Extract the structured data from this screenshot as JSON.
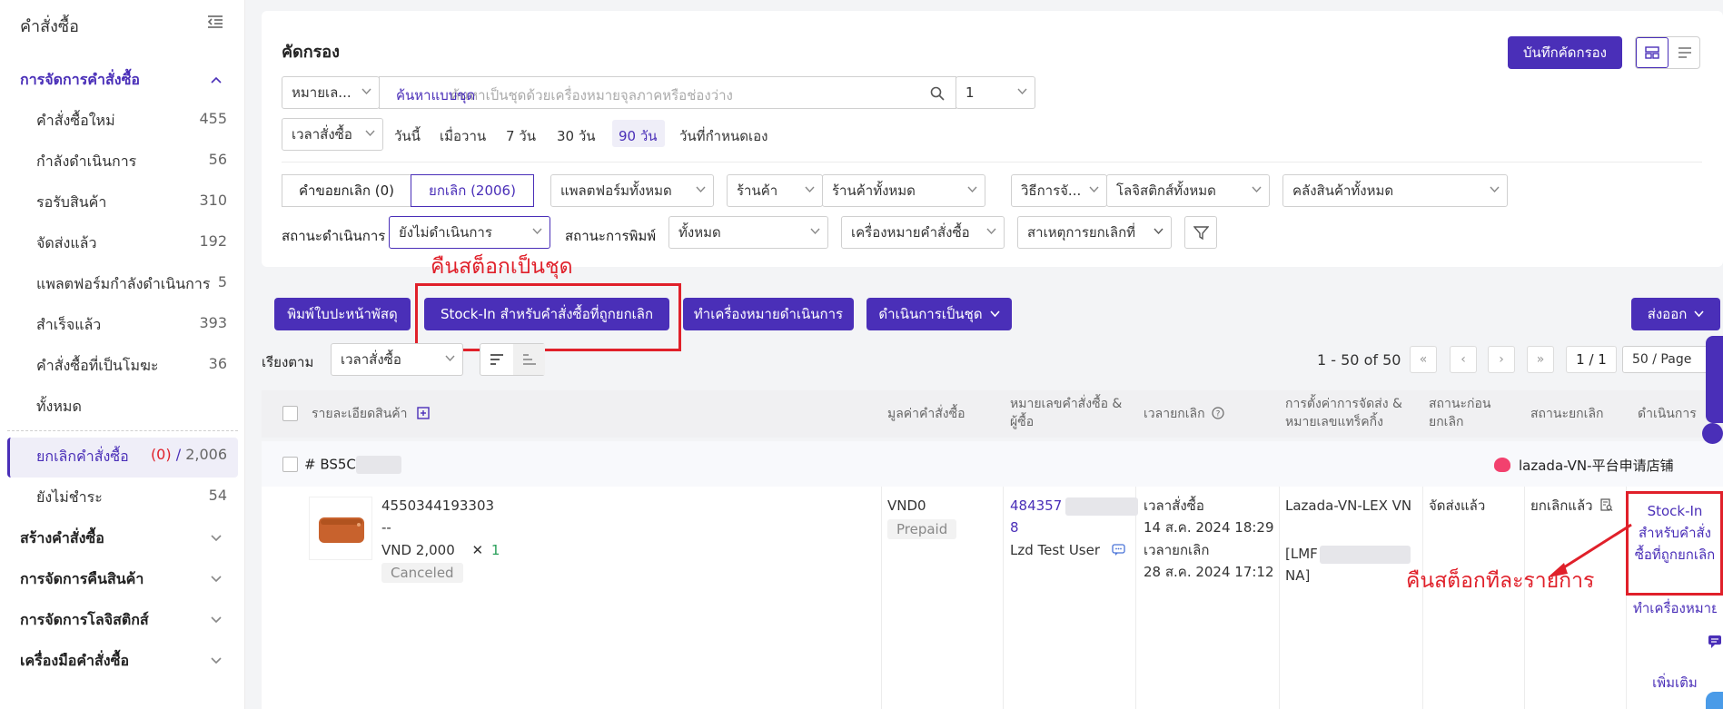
{
  "sidebar": {
    "title": "คำสั่งซื้อ",
    "sections": {
      "manage": "การจัดการคำสั่งซื้อ",
      "create": "สร้างคำสั่งซื้อ",
      "returns": "การจัดการคืนสินค้า",
      "logistics": "การจัดการโลจิสติกส์",
      "tools": "เครื่องมือคำสั่งซื้อ"
    },
    "items": [
      {
        "label": "คำสั่งซื้อใหม่",
        "count": "455"
      },
      {
        "label": "กำลังดำเนินการ",
        "count": "56"
      },
      {
        "label": "รอรับสินค้า",
        "count": "310"
      },
      {
        "label": "จัดส่งแล้ว",
        "count": "192"
      },
      {
        "label": "แพลตฟอร์มกำลังดำเนินการ",
        "count": "5"
      },
      {
        "label": "สำเร็จแล้ว",
        "count": "393"
      },
      {
        "label": "คำสั่งซื้อที่เป็นโมฆะ",
        "count": "36"
      },
      {
        "label": "ทั้งหมด",
        "count": ""
      }
    ],
    "cancel_item": {
      "label": "ยกเลิกคำสั่งซื้อ",
      "count_a": "(0)",
      "sep": "/",
      "count_b": "2,006"
    },
    "unpaid_item": {
      "label": "ยังไม่ชำระ",
      "count": "54"
    }
  },
  "filter": {
    "title": "คัดกรอง",
    "save_button": "บันทึกคัดกรอง",
    "search_type": "หมายเล...",
    "search_mode": "ค้นหาแบบชุด",
    "search_placeholder": "ค้นหาเป็นชุดด้วยเครื่องหมายจุลภาคหรือช่องว่าง",
    "search_count": "1",
    "time_select": "เวลาสั่งซื้อ",
    "time_options": [
      "วันนี้",
      "เมื่อวาน",
      "7 วัน",
      "30 วัน",
      "90 วัน",
      "วันที่กำหนดเอง"
    ],
    "time_selected": "90 วัน",
    "cancel_request_tab": "คำขอยกเลิก (0)",
    "canceled_tab": "ยกเลิก (2006)",
    "platform_select": "แพลตฟอร์มทั้งหมด",
    "shop_label": "ร้านค้า",
    "shop_select": "ร้านค้าทั้งหมด",
    "method_label": "วิธีการจั...",
    "logistics_select": "โลจิสติกส์ทั้งหมด",
    "warehouse_select": "คลังสินค้าทั้งหมด",
    "process_status_label": "สถานะดำเนินการ",
    "process_status_select": "ยังไม่ดำเนินการ",
    "print_status_label": "สถานะการพิมพ์",
    "print_status_select": "ทั้งหมด",
    "order_mark_select": "เครื่องหมายคำสั่งซื้อ",
    "cancel_reason_select": "สาเหตุการยกเลิกที่"
  },
  "annotations": {
    "batch_restock": "คืนสต็อกเป็นชุด",
    "per_item_restock": "คืนสต็อกทีละรายการ"
  },
  "actions": {
    "print_label": "พิมพ์ใบปะหน้าพัสดุ",
    "stock_in": "Stock-In สำหรับคำสั่งซื้อที่ถูกยกเลิก",
    "mark_processed": "ทำเครื่องหมายดำเนินการ",
    "batch_process": "ดำเนินการเป็นชุด",
    "export": "ส่งออก"
  },
  "sort": {
    "label": "เรียงตาม",
    "select": "เวลาสั่งซื้อ"
  },
  "pagination": {
    "range": "1 - 50 of 50",
    "page": "1 / 1",
    "per_page": "50 / Page"
  },
  "table": {
    "headers": {
      "product": "รายละเอียดสินค้า",
      "amount": "มูลค่าคำสั่งซื้อ",
      "order_no": "หมายเลขคำสั่งซื้อ & ผู้ซื้อ",
      "cancel_time": "เวลายกเลิก",
      "shipping": "การตั้งค่าการจัดส่ง & หมายเลขแทร็คกิ้ง",
      "prev_status": "สถานะก่อนยกเลิก",
      "cancel_status": "สถานะยกเลิก",
      "action": "ดำเนินการ"
    },
    "order": {
      "package_prefix": "# BS5C",
      "store_badge": "Lazada",
      "store_name": "lazada-VN-平台申请店铺",
      "sku": "4550344193303",
      "variant": "--",
      "price": "VND 2,000",
      "qty_x": "✕",
      "qty": "1",
      "item_status": "Canceled",
      "amount": "VND0",
      "payment": "Prepaid",
      "order_no_a": "484357",
      "order_no_b": "8",
      "buyer": "Lzd Test User",
      "order_time_label": "เวลาสั่งซื้อ",
      "order_time": "14 ส.ค. 2024 18:29",
      "cancel_time_label": "เวลายกเลิก",
      "cancel_time": "28 ส.ค. 2024 17:12",
      "carrier": "Lazada-VN-LEX VN",
      "tracking_a": "[LMF",
      "tracking_b": "NA]",
      "prev_status": "จัดส่งแล้ว",
      "cancel_status": "ยกเลิกแล้ว",
      "action_stock_in": "Stock-In สำหรับคำสั่งซื้อที่ถูกยกเลิก",
      "action_mark": "ทำเครื่องหมายดำเนินการ",
      "action_more": "เพิ่มเติม"
    }
  },
  "colors": {
    "primary": "#4a2fb8",
    "annotation_red": "#e0202a",
    "lazada_pink": "#f2416e"
  }
}
